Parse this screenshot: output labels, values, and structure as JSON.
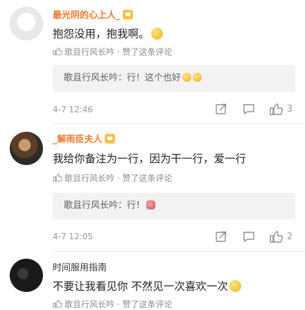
{
  "comments": [
    {
      "username": "最光阴的心上人_",
      "content": "抱怨没用，抱我啊。",
      "liked_by": "歌且行风长吟 · 赞了这条评论",
      "reply_author": "歌且行风长吟",
      "reply_text": "：行！这个也好",
      "time": "4-7 12:46",
      "likes": "3"
    },
    {
      "username": "_解雨臣夫人",
      "content": "我给你备注为一行，因为干一行，爱一行",
      "liked_by": "歌且行风长吟 · 赞了这条评论",
      "reply_author": "歌且行风长吟",
      "reply_text": "：行！",
      "time": "4-7 12:05",
      "likes": "2"
    },
    {
      "username": "时间服用指南",
      "content": "不要让我看见你 不然见一次喜欢一次",
      "liked_by": "歌且行风长吟 · 赞了这条评论"
    }
  ],
  "icons": {
    "vip_badge": "vip-badge-icon",
    "emoji": "smile-emoji-icon",
    "share": "share-icon",
    "comment": "comment-icon",
    "like": "thumb-up-icon"
  },
  "colors": {
    "vip_name": "#ef7a2c",
    "reply_bg": "#f2f2f2",
    "secondary_text": "#999999"
  }
}
